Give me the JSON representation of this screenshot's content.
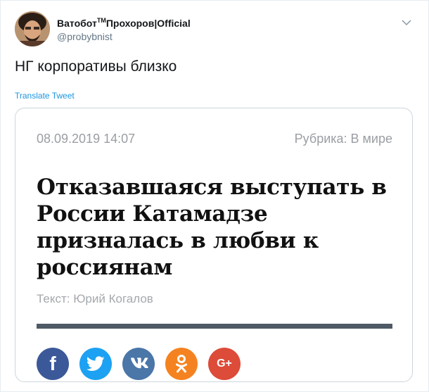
{
  "tweet": {
    "display_name": "Ватобот",
    "tm_mark": "TM",
    "display_name_suffix": "Прохоров|Official",
    "handle": "@probybnist",
    "text": "НГ корпоративы близко",
    "translate_label": "Translate Tweet"
  },
  "article": {
    "date": "08.09.2019 14:07",
    "rubric": "Рубрика: В мире",
    "headline": "Отказавшаяся выступать в России Катамадзе призналась в любви к россиянам",
    "author": "Текст: Юрий Когалов"
  },
  "share_buttons": [
    {
      "name": "facebook",
      "label": "f",
      "color": "#3b5998"
    },
    {
      "name": "twitter",
      "color": "#1da1f2"
    },
    {
      "name": "vk",
      "color": "#4a76a8"
    },
    {
      "name": "odnoklassniki",
      "color": "#f58220"
    },
    {
      "name": "google-plus",
      "label": "G+",
      "color": "#dd4b39"
    }
  ]
}
